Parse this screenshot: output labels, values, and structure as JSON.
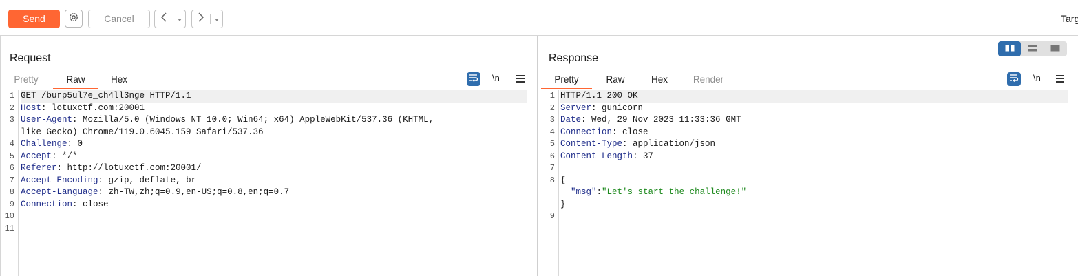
{
  "toolbar": {
    "send_label": "Send",
    "cancel_label": "Cancel",
    "target_label": "Targ",
    "icons": [
      "gear-icon",
      "back-arrow-icon",
      "forward-arrow-icon",
      "dropdown-icon"
    ],
    "accent_color": "#ff6633"
  },
  "request": {
    "title": "Request",
    "tabs": [
      {
        "label": "Pretty",
        "active": false
      },
      {
        "label": "Raw",
        "active": true
      },
      {
        "label": "Hex",
        "active": false
      }
    ],
    "newline_toggle": "\\n",
    "line_numbers": [
      "1",
      "2",
      "3",
      "4",
      "5",
      "6",
      "7",
      "8",
      "9",
      "10",
      "11"
    ],
    "lines": {
      "l1": {
        "text": "GET /burp5ul7e_ch4ll3nge HTTP/1.1"
      },
      "l2": {
        "key": "Host",
        "value": " lotuxctf.com:20001"
      },
      "l3": {
        "key": "User-Agent",
        "value": " Mozilla/5.0 (Windows NT 10.0; Win64; x64) AppleWebKit/537.36 (KHTML,"
      },
      "l3b": {
        "text": "like Gecko) Chrome/119.0.6045.159 Safari/537.36"
      },
      "l4": {
        "key": "Challenge",
        "value": " 0"
      },
      "l5": {
        "key": "Accept",
        "value": " */*"
      },
      "l6": {
        "key": "Referer",
        "value": " http://lotuxctf.com:20001/"
      },
      "l7": {
        "key": "Accept-Encoding",
        "value": " gzip, deflate, br"
      },
      "l8": {
        "key": "Accept-Language",
        "value": " zh-TW,zh;q=0.9,en-US;q=0.8,en;q=0.7"
      },
      "l9": {
        "key": "Connection",
        "value": " close"
      }
    }
  },
  "response": {
    "title": "Response",
    "tabs": [
      {
        "label": "Pretty",
        "active": true
      },
      {
        "label": "Raw",
        "active": false
      },
      {
        "label": "Hex",
        "active": false
      },
      {
        "label": "Render",
        "active": false
      }
    ],
    "newline_toggle": "\\n",
    "line_numbers": [
      "1",
      "2",
      "3",
      "4",
      "5",
      "6",
      "7",
      "8",
      "9"
    ],
    "lines": {
      "l1": {
        "text": "HTTP/1.1 200 OK"
      },
      "l2": {
        "key": "Server",
        "value": " gunicorn"
      },
      "l3": {
        "key": "Date",
        "value": " Wed, 29 Nov 2023 11:33:36 GMT"
      },
      "l4": {
        "key": "Connection",
        "value": " close"
      },
      "l5": {
        "key": "Content-Type",
        "value": " application/json"
      },
      "l6": {
        "key": "Content-Length",
        "value": " 37"
      },
      "l8": {
        "text": "{"
      },
      "l8b": {
        "json_key": "\"msg\"",
        "colon": ":",
        "json_value": "\"Let's start the challenge!\""
      },
      "l8c": {
        "text": "}"
      }
    }
  }
}
